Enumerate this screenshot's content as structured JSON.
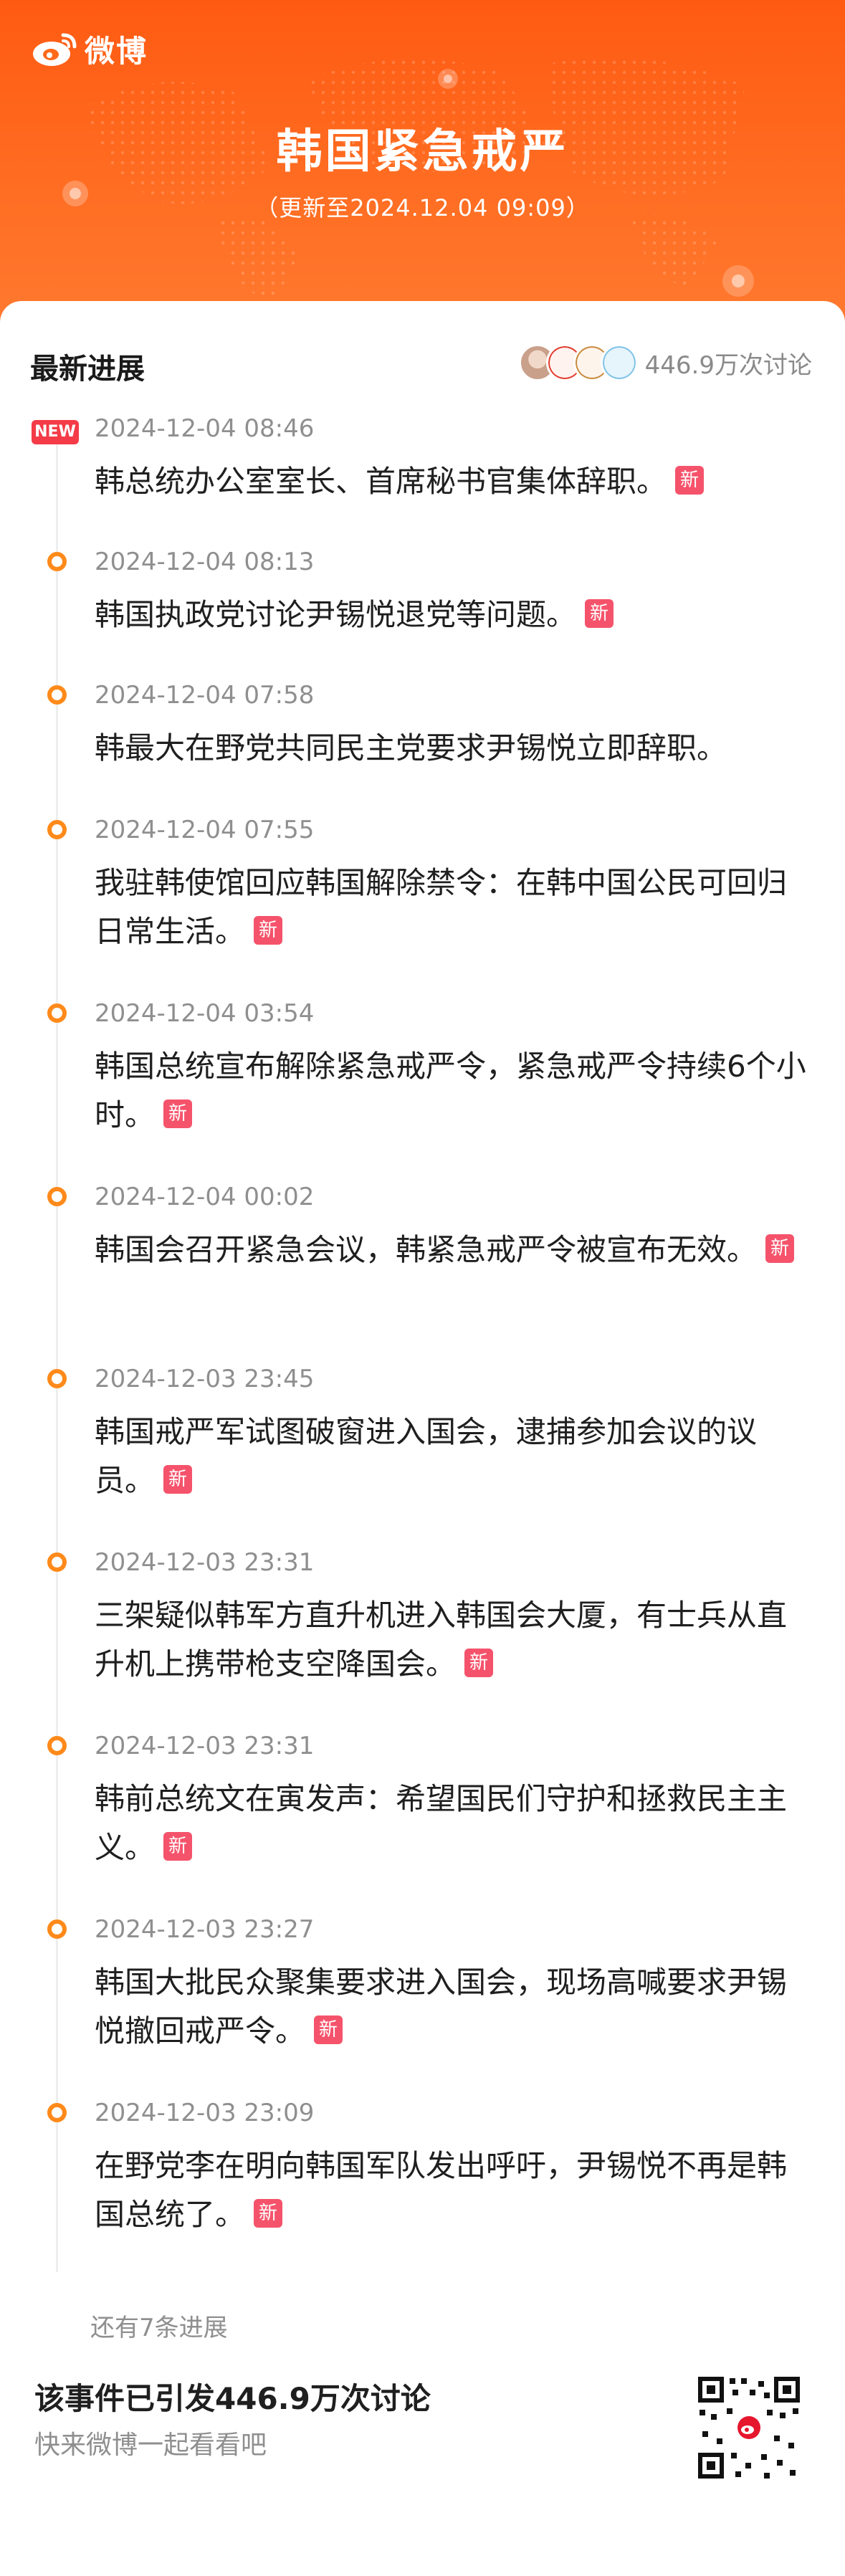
{
  "brand": {
    "name": "微博",
    "logo_icon": "weibo-eye-icon"
  },
  "hero": {
    "title": "韩国紧急戒严",
    "subtitle": "（更新至2024.12.04 09:09）"
  },
  "progress": {
    "section_title": "最新进展",
    "discussion_count": "446.9万次讨论",
    "new_tag": "NEW",
    "xin_tag": "新",
    "entries": [
      {
        "time": "2024-12-04 08:46",
        "text": "韩总统办公室室长、首席秘书官集体辞职。",
        "is_new": true
      },
      {
        "time": "2024-12-04 08:13",
        "text": "韩国执政党讨论尹锡悦退党等问题。",
        "is_new": true
      },
      {
        "time": "2024-12-04 07:58",
        "text": "韩最大在野党共同民主党要求尹锡悦立即辞职。",
        "is_new": false
      },
      {
        "time": "2024-12-04 07:55",
        "text": "我驻韩使馆回应韩国解除禁令：在韩中国公民可回归日常生活。",
        "is_new": true
      },
      {
        "time": "2024-12-04 03:54",
        "text": "韩国总统宣布解除紧急戒严令，紧急戒严令持续6个小时。",
        "is_new": true
      },
      {
        "time": "2024-12-04 00:02",
        "text": "韩国会召开紧急会议，韩紧急戒严令被宣布无效。",
        "is_new": true
      },
      {
        "time": "2024-12-03 23:45",
        "text": "韩国戒严军试图破窗进入国会，逮捕参加会议的议员。",
        "is_new": true
      },
      {
        "time": "2024-12-03 23:31",
        "text": "三架疑似韩军方直升机进入韩国会大厦，有士兵从直升机上携带枪支空降国会。",
        "is_new": true
      },
      {
        "time": "2024-12-03 23:31",
        "text": "韩前总统文在寅发声：希望国民们守护和拯救民主主义。",
        "is_new": true
      },
      {
        "time": "2024-12-03 23:27",
        "text": "韩国大批民众聚集要求进入国会，现场高喊要求尹锡悦撤回戒严令。",
        "is_new": true
      },
      {
        "time": "2024-12-03 23:09",
        "text": "在野党李在明向韩国军队发出呼吁，尹锡悦不再是韩国总统了。",
        "is_new": true
      }
    ],
    "more_text": "还有7条进展"
  },
  "footer": {
    "title": "该事件已引发446.9万次讨论",
    "subtitle": "快来微博一起看看吧",
    "qr_icon": "qr-code-icon"
  },
  "colors": {
    "header": "#ff6a1a",
    "timeline_dot": "#ff8a1a",
    "new_badge": "#f43b47",
    "xin_badge": "#f5536b"
  }
}
